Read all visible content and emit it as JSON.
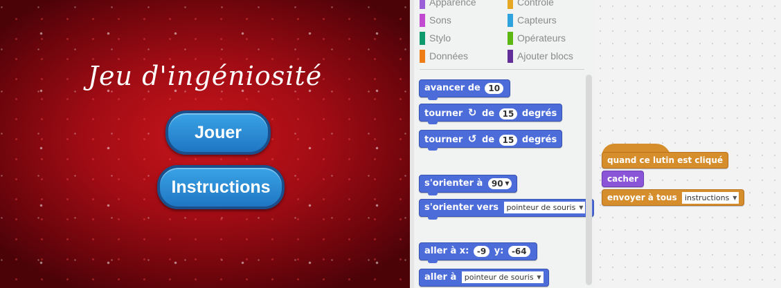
{
  "stage": {
    "title": "Jeu d'ingéniosité",
    "play_button": "Jouer",
    "instructions_button": "Instructions"
  },
  "categories": [
    {
      "label": "Apparence",
      "color": "#9a5ed6"
    },
    {
      "label": "Contrôle",
      "color": "#e6a823"
    },
    {
      "label": "Sons",
      "color": "#c24ad0"
    },
    {
      "label": "Capteurs",
      "color": "#2ea3dd"
    },
    {
      "label": "Stylo",
      "color": "#0e9a6c"
    },
    {
      "label": "Opérateurs",
      "color": "#5cb712"
    },
    {
      "label": "Données",
      "color": "#ee7d16"
    },
    {
      "label": "Ajouter blocs",
      "color": "#632d99"
    }
  ],
  "palette_blocks": {
    "move": {
      "text": "avancer de",
      "value": "10"
    },
    "turn_right": {
      "text": "tourner",
      "icon": "rotate-clockwise-icon",
      "mid": "de",
      "value": "15",
      "suffix": "degrés"
    },
    "turn_left": {
      "text": "tourner",
      "icon": "rotate-counterclockwise-icon",
      "mid": "de",
      "value": "15",
      "suffix": "degrés"
    },
    "point_direction": {
      "text": "s'orienter à",
      "value": "90"
    },
    "point_towards": {
      "text": "s'orienter vers",
      "option": "pointeur de souris"
    },
    "goto_xy": {
      "text": "aller à x:",
      "x": "-9",
      "ylabel": "y:",
      "y": "-64"
    },
    "goto": {
      "text": "aller à",
      "option": "pointeur de souris"
    }
  },
  "script": {
    "hat": "quand ce lutin est cliqué",
    "hide": "cacher",
    "broadcast": {
      "text": "envoyer à tous",
      "option": "instructions"
    }
  }
}
